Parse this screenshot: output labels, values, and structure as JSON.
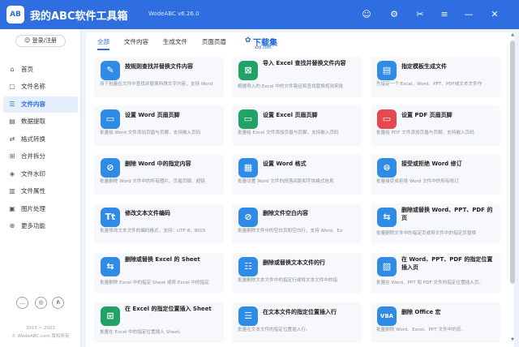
{
  "app": {
    "logo_text": "AB",
    "title": "我的ABC软件工具箱",
    "version": "WodeABC v6.26.0",
    "colors": {
      "accent": "#2f6ee0",
      "sidebar_bg": "#ffffff",
      "page_bg": "#eef2f9"
    }
  },
  "titlebar_icons": [
    {
      "name": "user-icon",
      "glyph": "☺"
    },
    {
      "name": "settings-gear-icon",
      "glyph": "⚙"
    },
    {
      "name": "scissors-icon",
      "glyph": "✂"
    },
    {
      "name": "menu-icon",
      "glyph": "≡"
    },
    {
      "name": "minimize-icon",
      "glyph": "—"
    },
    {
      "name": "close-icon",
      "glyph": "✕"
    }
  ],
  "sidebar": {
    "login_label": "登录/注册",
    "items": [
      {
        "label": "首页",
        "icon": "⌂",
        "icon_name": "home-icon",
        "active": false
      },
      {
        "label": "文件名称",
        "icon": "▢",
        "icon_name": "file-name-icon",
        "active": false
      },
      {
        "label": "文件内容",
        "icon": "☰",
        "icon_name": "file-content-icon",
        "active": true
      },
      {
        "label": "数据提取",
        "icon": "▤",
        "icon_name": "data-extract-icon",
        "active": false
      },
      {
        "label": "格式转换",
        "icon": "⇄",
        "icon_name": "format-convert-icon",
        "active": false
      },
      {
        "label": "合并拆分",
        "icon": "⊞",
        "icon_name": "merge-split-icon",
        "active": false
      },
      {
        "label": "文件水印",
        "icon": "◈",
        "icon_name": "watermark-icon",
        "active": false
      },
      {
        "label": "文件属性",
        "icon": "▥",
        "icon_name": "file-attribute-icon",
        "active": false
      },
      {
        "label": "图片处理",
        "icon": "▣",
        "icon_name": "image-process-icon",
        "active": false
      },
      {
        "label": "更多功能",
        "icon": "⊕",
        "icon_name": "more-features-icon",
        "active": false
      }
    ],
    "bottom_icons": [
      {
        "name": "chat-icon",
        "glyph": "…"
      },
      {
        "name": "support-icon",
        "glyph": "◎"
      },
      {
        "name": "share-icon",
        "glyph": "⋔"
      }
    ],
    "copyright_line1": "2015 ~ 2022",
    "copyright_line2": "© WodeABC.com 版权所有"
  },
  "tabs": [
    {
      "label": "全部",
      "active": true
    },
    {
      "label": "文件内容",
      "active": false
    },
    {
      "label": "生成文件",
      "active": false
    },
    {
      "label": "页面页眉",
      "active": false
    }
  ],
  "watermark": {
    "main": "下载集",
    "sub": "xzji.com",
    "glyph": "✿"
  },
  "cards": [
    {
      "title": "按规则查找并替换文件内容",
      "desc": "用于批量在文件中查找并替换特殊文字内容，支持 Word",
      "icon": "✎",
      "color": "#2f8be6",
      "icon_name": "find-replace-icon"
    },
    {
      "title": "导入 Excel 查找并替换文件内容",
      "desc": "根据导入的 Excel 中的文件路径和查找替换规则来批",
      "icon": "⊠",
      "color": "#21a366",
      "icon_name": "excel-import-icon"
    },
    {
      "title": "指定模板生成文件",
      "desc": "先指定一个 Excel、Word、PPT、PDF或文本文件作",
      "icon": "▤",
      "color": "#2f8be6",
      "icon_name": "template-generate-icon"
    },
    {
      "title": "设置 Word 页眉页脚",
      "desc": "批量给 Word 文件添加页眉与页脚，支持嵌入页码",
      "icon": "▭",
      "color": "#2f8be6",
      "icon_name": "word-header-footer-icon"
    },
    {
      "title": "设置 Excel 页眉页脚",
      "desc": "批量给 Excel 文件添加页眉与页脚，支持嵌入页码",
      "icon": "▭",
      "color": "#21a366",
      "icon_name": "excel-header-footer-icon"
    },
    {
      "title": "设置 PDF 页眉页脚",
      "desc": "批量给 PDF 文件添加页眉与页脚，支持嵌入页码",
      "icon": "▭",
      "color": "#e5484d",
      "icon_name": "pdf-header-footer-icon"
    },
    {
      "title": "删除 Word 中的指定内容",
      "desc": "批量删除 Word 文件中的所有图片、页眉页脚、超链",
      "icon": "⊘",
      "color": "#2f8be6",
      "icon_name": "word-delete-icon"
    },
    {
      "title": "设置 Word 格式",
      "desc": "批量设置 Word 文件的段落间距和字体格式信息",
      "icon": "▦",
      "color": "#2f8be6",
      "icon_name": "word-format-icon"
    },
    {
      "title": "接受或拒绝 Word 修订",
      "desc": "批量接受或拒绝 Word 文件中的所有修订",
      "icon": "⊜",
      "color": "#2f8be6",
      "icon_name": "word-revision-icon"
    },
    {
      "title": "修改文本文件编码",
      "desc": "批量修改文本文件的编码格式，支持：UTF-8、BIG5",
      "icon": "Tt",
      "color": "#2f8be6",
      "icon_name": "text-encoding-icon"
    },
    {
      "title": "删除文件空白内容",
      "desc": "批量删除文件中的空白页和空白行，支持 Word、Ex",
      "icon": "⊘",
      "color": "#2f8be6",
      "icon_name": "delete-blank-icon"
    },
    {
      "title": "删除或替换 Word、PPT、PDF 的页",
      "desc": "批量删除文件中的指定页或将文件中的指定页替换",
      "icon": "⇆",
      "color": "#2f8be6",
      "icon_name": "page-delete-replace-icon"
    },
    {
      "title": "删除或替换 Excel 的 Sheet",
      "desc": "批量删除 Excel 中的指定 Sheet 或将 Excel 中的指定",
      "icon": "⇆",
      "color": "#2f8be6",
      "icon_name": "excel-sheet-replace-icon"
    },
    {
      "title": "删除或替换文本文件的行",
      "desc": "批量删除文本文件中的指定行或将文本文件中的指",
      "icon": "☷",
      "color": "#2f8be6",
      "icon_name": "text-line-replace-icon"
    },
    {
      "title": "在 Word、PPT、PDF 的指定位置插入页",
      "desc": "批量在 Word、PPT 和 PDF 文件的指定位置插入页。",
      "icon": "▧",
      "color": "#2f8be6",
      "icon_name": "insert-page-icon"
    },
    {
      "title": "在 Excel 的指定位置插入 Sheet",
      "desc": "批量在 Excel 中的指定位置插入 Sheet。",
      "icon": "⊞",
      "color": "#21a366",
      "icon_name": "insert-sheet-icon"
    },
    {
      "title": "在文本文件的指定位置插入行",
      "desc": "批量在文本文件的指定位置插入行。",
      "icon": "☰",
      "color": "#2f8be6",
      "icon_name": "insert-line-icon"
    },
    {
      "title": "删除 Office 宏",
      "desc": "批量删除 Word、Excel、PPT 文件中的宏。",
      "icon": "VBA",
      "color": "#2f8be6",
      "icon_name": "delete-macro-icon"
    }
  ]
}
